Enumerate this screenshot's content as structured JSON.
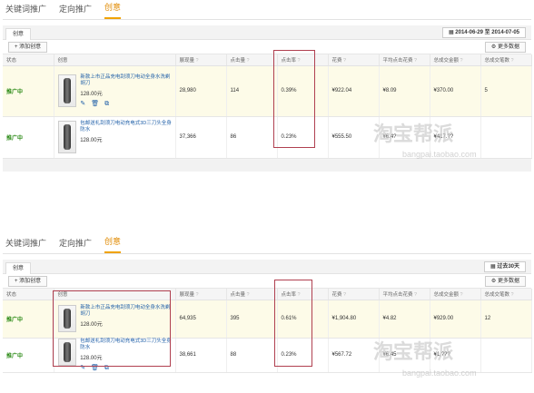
{
  "tabs": [
    "关键词推广",
    "定向推广",
    "创意"
  ],
  "inner_tab": "创意",
  "panel1": {
    "date_range": "2014-06-29 至 2014-07-05"
  },
  "panel2": {
    "date_range": "过去30天"
  },
  "add_button": "+ 添加创意",
  "more_button": "更多数据",
  "headers": [
    "状态",
    "创意",
    "展现量",
    "点击量",
    "点击率",
    "花费",
    "平均点击花费",
    "总成交金额",
    "总成交笔数"
  ],
  "panel1_rows": [
    {
      "status": "推广中",
      "title": "新款上市正品充电刮须刀电动全身水洗剃胡刀",
      "price": "128.00元",
      "impressions": "28,980",
      "clicks": "114",
      "ctr": "0.39%",
      "cost": "¥922.04",
      "cpc": "¥8.09",
      "gmv": "¥370.00",
      "orders": "5"
    },
    {
      "status": "推广中",
      "title": "包邮送礼刮须刀电动充电式3D三刀头全身防水",
      "price": "128.00元",
      "impressions": "37,366",
      "clicks": "86",
      "ctr": "0.23%",
      "cost": "¥555.50",
      "cpc": "¥6.4?",
      "gmv": "¥417.??",
      "orders": ""
    }
  ],
  "panel2_rows": [
    {
      "status": "推广中",
      "title": "新款上市正品充电刮须刀电动全身水洗剃胡刀",
      "price": "128.00元",
      "impressions": "64,935",
      "clicks": "395",
      "ctr": "0.61%",
      "cost": "¥1,904.80",
      "cpc": "¥4.82",
      "gmv": "¥929.00",
      "orders": "12"
    },
    {
      "status": "推广中",
      "title": "包邮送礼刮须刀电动充电式3D三刀头全身防水",
      "price": "128.00元",
      "impressions": "38,661",
      "clicks": "88",
      "ctr": "0.23%",
      "cost": "¥567.72",
      "cpc": "¥6.45",
      "gmv": "¥1,???",
      "orders": ""
    }
  ],
  "watermark": "淘宝帮派",
  "watermark_url": "bangpai.taobao.com",
  "row_icons": "✎ 🗑 ⧉",
  "colors": {
    "active_tab": "#e08a00",
    "status_green": "#2b8a16",
    "link_blue": "#1f5fa8",
    "highlight_box": "#b04050",
    "row_yellow": "#fdfbe8"
  }
}
